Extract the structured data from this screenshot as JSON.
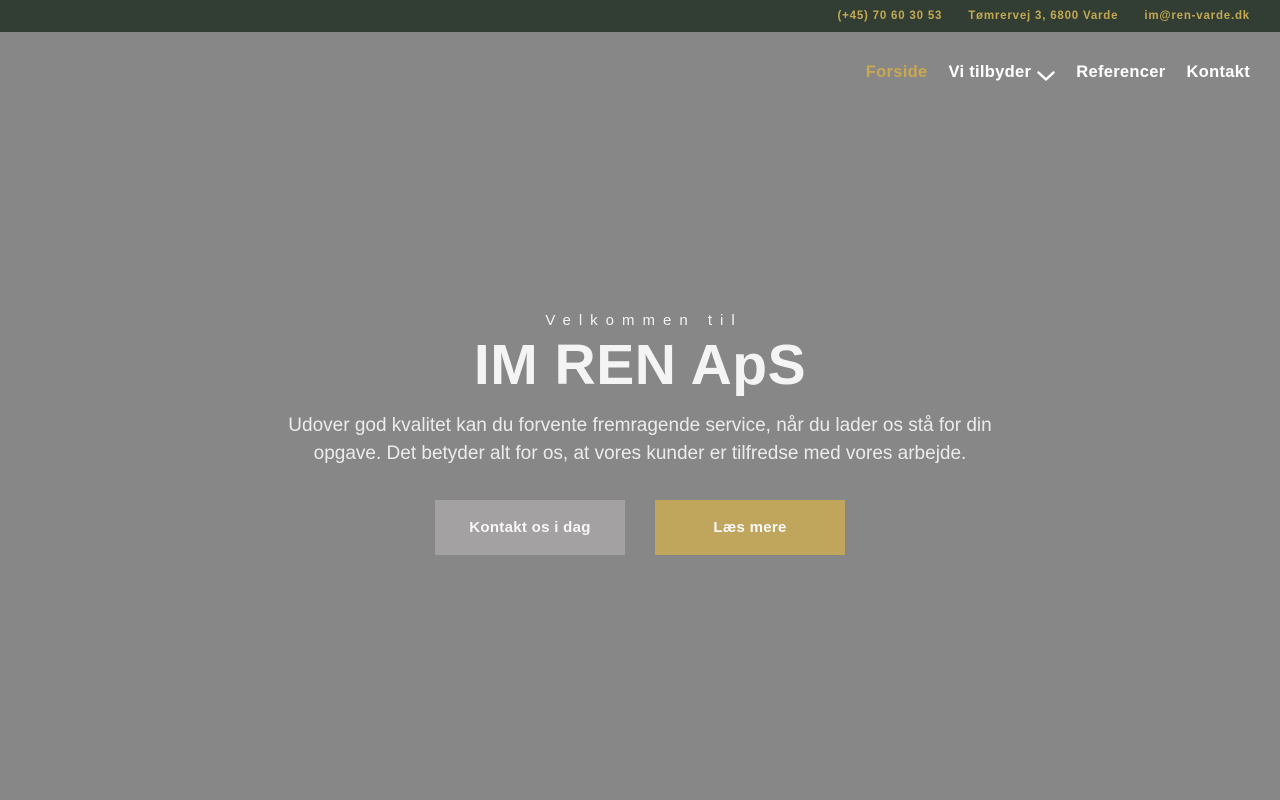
{
  "topbar": {
    "phone": "(+45) 70 60 30 53",
    "address": "Tømrervej 3, 6800 Varde",
    "email": "im@ren-varde.dk"
  },
  "nav": {
    "items": [
      {
        "label": "Forside",
        "active": true
      },
      {
        "label": "Vi tilbyder",
        "has_dropdown": true
      },
      {
        "label": "Referencer",
        "active": false
      },
      {
        "label": "Kontakt",
        "active": false
      }
    ]
  },
  "hero": {
    "eyebrow": "Velkommen til",
    "title": "IM REN ApS",
    "subtitle": "Udover god kvalitet kan du forvente fremragende service, når du lader os stå for din opgave. Det betyder alt for os, at vores kunder er tilfredse med vores arbejde.",
    "buttons": {
      "contact_label": "Kontakt os i dag",
      "read_more_label": "Læs mere"
    }
  },
  "colors": {
    "topbar_bg": "#323e33",
    "topbar_text": "#c2a853",
    "nav_active": "#c9a850",
    "page_bg": "#878787",
    "button_gray": "#a3a1a1",
    "button_gold": "#bfa65c"
  }
}
